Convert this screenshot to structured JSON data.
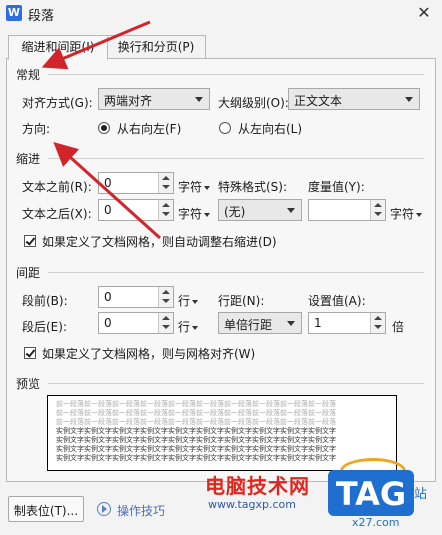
{
  "window": {
    "title": "段落",
    "app_icon": "W",
    "close": "✕"
  },
  "tabs": [
    {
      "label": "缩进和间距(I)",
      "active": true
    },
    {
      "label": "换行和分页(P)",
      "active": false
    }
  ],
  "general": {
    "title": "常规",
    "align_label": "对齐方式(G):",
    "align_value": "两端对齐",
    "outline_label": "大纲级别(O):",
    "outline_value": "正文文本",
    "direction_label": "方向:",
    "rtl_label": "从右向左(F)",
    "ltr_label": "从左向右(L)",
    "rtl_selected": true
  },
  "indent": {
    "title": "缩进",
    "before_label": "文本之前(R):",
    "before_value": "0",
    "before_unit": "字符",
    "after_label": "文本之后(X):",
    "after_value": "0",
    "after_unit": "字符",
    "special_label": "特殊格式(S):",
    "special_value": "(无)",
    "measure_label": "度量值(Y):",
    "measure_value": "",
    "measure_unit": "字符",
    "auto_adjust_label": "如果定义了文档网格，则自动调整右缩进(D)",
    "auto_adjust_checked": true
  },
  "spacing": {
    "title": "间距",
    "before_label": "段前(B):",
    "before_value": "0",
    "before_unit": "行",
    "after_label": "段后(E):",
    "after_value": "0",
    "after_unit": "行",
    "line_label": "行距(N):",
    "line_value": "单倍行距",
    "setting_label": "设置值(A):",
    "setting_value": "1",
    "setting_unit": "倍",
    "snap_grid_label": "如果定义了文档网格，则与网格对齐(W)",
    "snap_grid_checked": true
  },
  "preview": {
    "title": "预览",
    "prev_text": "前一段落前一段落前一段落前一段落前一段落前一段落前一段落前一段落前一段落前一段落",
    "sample_text": "实例文字实例文字实例文字实例文字实例文字实例文字实例文字实例文字实例文字实例文字"
  },
  "footer": {
    "tabs_button": "制表位(T)...",
    "tips_label": "操作技巧"
  },
  "watermark": {
    "title": "电脑技术网",
    "url": "www.tagxp.com",
    "logo": "TAG",
    "side": "站",
    "sub": "x27.com"
  },
  "colors": {
    "arrow": "#d0262b",
    "accent": "#1f6fd1",
    "watermark_red": "#e0261d"
  }
}
